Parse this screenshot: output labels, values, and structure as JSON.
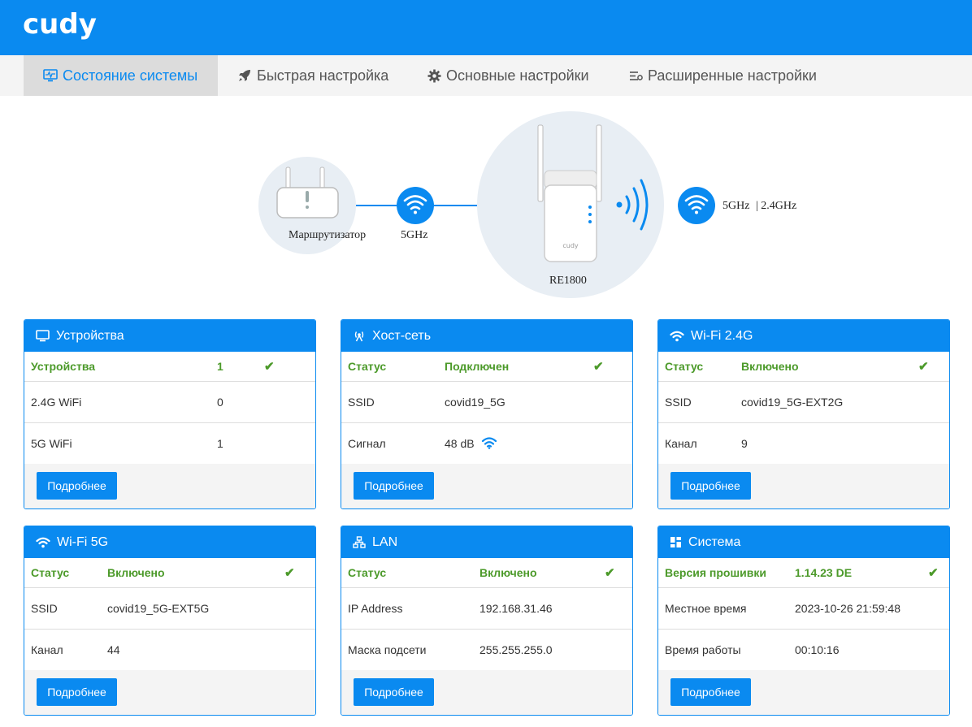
{
  "brand": {
    "logo_text": "cudy",
    "color": "#0a8af0"
  },
  "nav": {
    "tabs": [
      {
        "label": "Состояние системы",
        "icon": "monitor-icon",
        "active": true
      },
      {
        "label": "Быстрая настройка",
        "icon": "rocket-icon",
        "active": false
      },
      {
        "label": "Основные настройки",
        "icon": "gear-icon",
        "active": false
      },
      {
        "label": "Расширенные настройки",
        "icon": "sliders-icon",
        "active": false
      }
    ]
  },
  "diagram": {
    "router_label": "Маршрутизатор",
    "uplink_label": "5GHz",
    "device_label": "RE1800",
    "bands_label_a": "5GHz",
    "bands_label_b": "| 2.4GHz"
  },
  "cards": {
    "devices": {
      "title": "Устройства",
      "icon": "monitor-icon",
      "rows": [
        {
          "label": "Устройства",
          "value": "1"
        },
        {
          "label": "2.4G WiFi",
          "value": "0"
        },
        {
          "label": "5G WiFi",
          "value": "1"
        }
      ],
      "button": "Подробнее"
    },
    "host": {
      "title": "Хост-сеть",
      "icon": "antenna-icon",
      "rows": [
        {
          "label": "Статус",
          "value": "Подключен"
        },
        {
          "label": "SSID",
          "value": "covid19_5G"
        },
        {
          "label": "Сигнал",
          "value": "48 dB"
        }
      ],
      "button": "Подробнее"
    },
    "wifi24": {
      "title": "Wi-Fi 2.4G",
      "icon": "wifi-icon",
      "rows": [
        {
          "label": "Статус",
          "value": "Включено"
        },
        {
          "label": "SSID",
          "value": "covid19_5G-EXT2G"
        },
        {
          "label": "Канал",
          "value": "9"
        }
      ],
      "button": "Подробнее"
    },
    "wifi5": {
      "title": "Wi-Fi 5G",
      "icon": "wifi-icon",
      "rows": [
        {
          "label": "Статус",
          "value": "Включено"
        },
        {
          "label": "SSID",
          "value": "covid19_5G-EXT5G"
        },
        {
          "label": "Канал",
          "value": "44"
        }
      ],
      "button": "Подробнее"
    },
    "lan": {
      "title": "LAN",
      "icon": "network-icon",
      "rows": [
        {
          "label": "Статус",
          "value": "Включено"
        },
        {
          "label": "IP Address",
          "value": "192.168.31.46"
        },
        {
          "label": "Маска подсети",
          "value": "255.255.255.0"
        }
      ],
      "button": "Подробнее"
    },
    "system": {
      "title": "Система",
      "icon": "dashboard-icon",
      "rows": [
        {
          "label": "Версия прошивки",
          "value": "1.14.23 DE"
        },
        {
          "label": "Местное время",
          "value": "2023-10-26 21:59:48"
        },
        {
          "label": "Время работы",
          "value": "00:10:16"
        }
      ],
      "button": "Подробнее"
    }
  }
}
